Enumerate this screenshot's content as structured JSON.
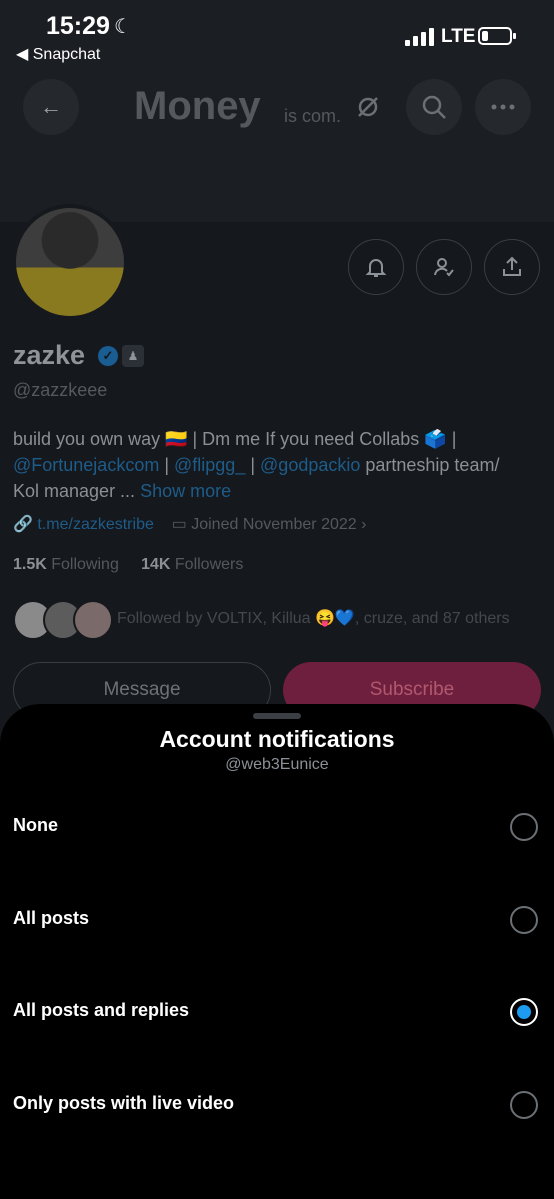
{
  "status_bar": {
    "time": "15:29",
    "back_app": "◀ Snapchat",
    "network": "LTE"
  },
  "nav": {
    "title": "Money",
    "subtitle": "is com."
  },
  "profile": {
    "name": "zazke",
    "handle": "@zazzkeee",
    "bio_1": "build you own way 🇨🇴 | Dm me If you need Collabs 🗳️ |",
    "bio_link_1": "@Fortunejackcom",
    "bio_sep_1": " | ",
    "bio_link_2": "@flipgg_",
    "bio_sep_2": " | ",
    "bio_link_3": "@godpackio",
    "bio_2": " partneship team/",
    "bio_3": "Kol manager ...",
    "show_more": "Show more",
    "website": "t.me/zazkestribe",
    "joined": "Joined November 2022",
    "following_count": "1.5K",
    "following_label": "Following",
    "followers_count": "14K",
    "followers_label": "Followers",
    "followed_by": "Followed by VOLTIX, Killua 😝💙, cruze, and 87 others",
    "message_label": "Message",
    "subscribe_label": "Subscribe"
  },
  "sheet": {
    "title": "Account notifications",
    "subtitle": "@web3Eunice",
    "options": [
      {
        "label": "None",
        "selected": false
      },
      {
        "label": "All posts",
        "selected": false
      },
      {
        "label": "All posts and replies",
        "selected": true
      },
      {
        "label": "Only posts with live video",
        "selected": false
      }
    ]
  },
  "colors": {
    "accent": "#1d9bf0",
    "subscribe": "#6e1f3d"
  }
}
